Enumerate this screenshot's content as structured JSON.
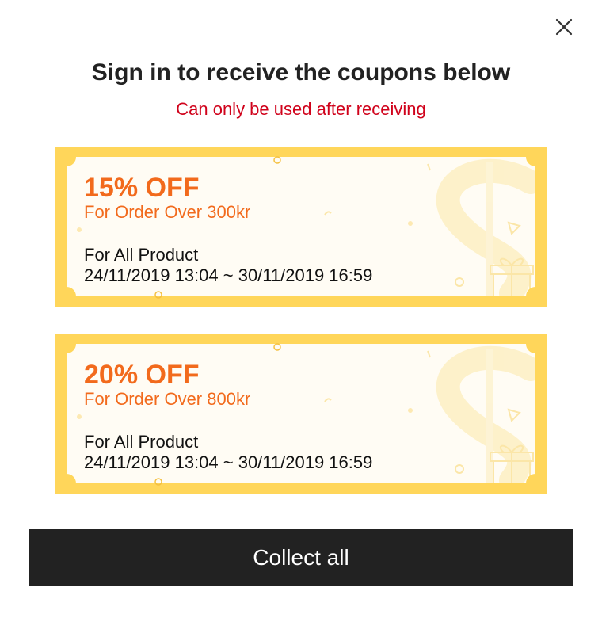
{
  "modal": {
    "title": "Sign in to receive the coupons below",
    "subtitle": "Can only be used after receiving",
    "close_icon": "close-icon"
  },
  "coupons": [
    {
      "discount": "15% OFF",
      "condition": "For Order Over 300kr",
      "scope": "For All Product",
      "validity": "24/11/2019 13:04 ~ 30/11/2019 16:59",
      "decor_icons": [
        "dollar-sign-icon",
        "gift-icon"
      ]
    },
    {
      "discount": "20% OFF",
      "condition": "For Order Over 800kr",
      "scope": "For All Product",
      "validity": "24/11/2019 13:04 ~ 30/11/2019 16:59",
      "decor_icons": [
        "dollar-sign-icon",
        "gift-icon"
      ]
    }
  ],
  "actions": {
    "collect_all_label": "Collect all"
  },
  "colors": {
    "accent": "#f26a1c",
    "notice": "#d0021b",
    "coupon_border": "#ffd65a",
    "coupon_inner": "#fffcf4",
    "button": "#222222"
  }
}
